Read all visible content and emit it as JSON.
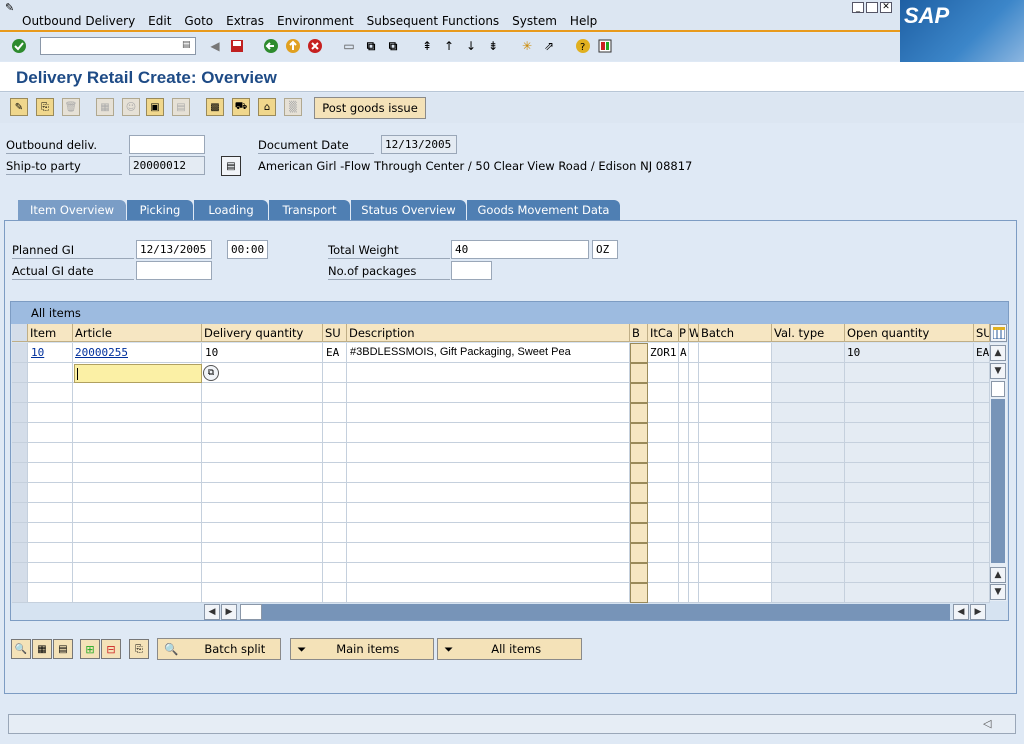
{
  "menu": [
    "Outbound Delivery",
    "Edit",
    "Goto",
    "Extras",
    "Environment",
    "Subsequent Functions",
    "System",
    "Help"
  ],
  "logo": "SAP",
  "title": "Delivery Retail  Create: Overview",
  "post_goods_issue": "Post goods issue",
  "header": {
    "outbound_label": "Outbound deliv.",
    "outbound_value": "",
    "shipto_label": "Ship-to party",
    "shipto_value": "20000012",
    "docdate_label": "Document Date",
    "docdate_value": "12/13/2005",
    "shipto_address": "American Girl -Flow Through Center / 50 Clear View Road / Edison NJ 08817"
  },
  "tabs": [
    "Item Overview",
    "Picking",
    "Loading",
    "Transport",
    "Status Overview",
    "Goods Movement Data"
  ],
  "overview": {
    "planned_gi_label": "Planned GI",
    "planned_gi_date": "12/13/2005",
    "planned_gi_time": "00:00",
    "actual_gi_label": "Actual GI date",
    "actual_gi_value": "",
    "total_weight_label": "Total Weight",
    "total_weight_value": "40",
    "weight_unit": "OZ",
    "packages_label": "No.of packages",
    "packages_value": ""
  },
  "table": {
    "title": "All items",
    "columns": [
      "Item",
      "Article",
      "Delivery quantity",
      "SU",
      "Description",
      "B",
      "ItCa",
      "P",
      "W",
      "Batch",
      "Val. type",
      "Open quantity",
      "SU"
    ],
    "row1": {
      "item": "10",
      "article": "20000255",
      "qty": "10",
      "su": "EA",
      "desc": "#3BDLESSMOIS, Gift Packaging, Sweet Pea",
      "itca": "ZOR1",
      "p": "A",
      "open": "10",
      "su2": "EA"
    }
  },
  "bottom_buttons": {
    "batch_split": "Batch split",
    "main_items": "Main items",
    "all_items": "All items"
  }
}
